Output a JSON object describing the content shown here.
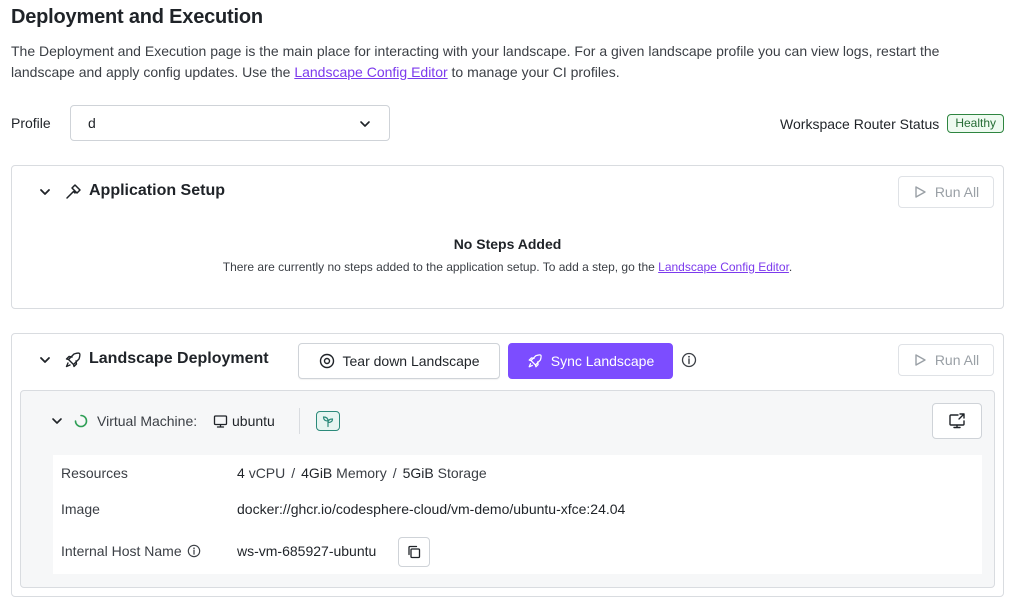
{
  "page": {
    "title": "Deployment and Execution",
    "description_prefix": "The Deployment and Execution page is the main place for interacting with your landscape. For a given landscape profile you can view logs, restart the landscape and apply config updates. Use the ",
    "description_link": "Landscape Config Editor",
    "description_suffix": " to manage your CI profiles."
  },
  "profile": {
    "label": "Profile",
    "selected": "d"
  },
  "workspace_router": {
    "label": "Workspace Router Status",
    "status": "Healthy"
  },
  "application_setup": {
    "title": "Application Setup",
    "run_all_label": "Run All",
    "empty_title": "No Steps Added",
    "empty_desc_prefix": "There are currently no steps added to the application setup. To add a step, go the ",
    "empty_desc_link": "Landscape Config Editor",
    "empty_desc_suffix": "."
  },
  "landscape_deployment": {
    "title": "Landscape Deployment",
    "teardown_label": "Tear down Landscape",
    "sync_label": "Sync Landscape",
    "run_all_label": "Run All",
    "vm": {
      "label": "Virtual Machine:",
      "name": "ubuntu",
      "resources_label": "Resources",
      "cpu_value": "4",
      "cpu_unit": "vCPU",
      "memory_value": "4GiB",
      "memory_unit": "Memory",
      "storage_value": "5GiB",
      "storage_unit": "Storage",
      "separator": "/",
      "image_label": "Image",
      "image_value": "docker://ghcr.io/codesphere-cloud/vm-demo/ubuntu-xfce:24.04",
      "host_label": "Internal Host Name",
      "host_value": "ws-vm-685927-ubuntu"
    }
  },
  "colors": {
    "accent": "#7c4dff",
    "link": "#7c3aed",
    "healthy": "#2e8540",
    "vm_tag": "#2b8a7a"
  }
}
